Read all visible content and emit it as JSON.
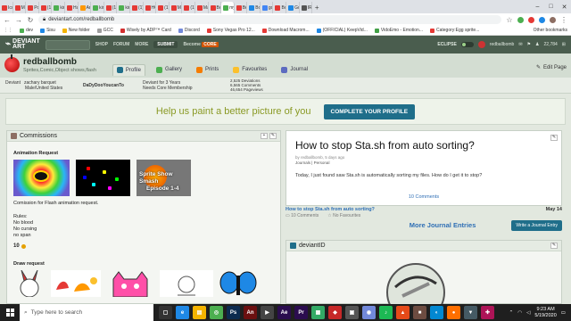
{
  "browser": {
    "tabs": [
      {
        "label": "Ico",
        "color": "#e53935"
      },
      {
        "label": "Ma",
        "color": "#e53935"
      },
      {
        "label": "Po",
        "color": "#e53935"
      },
      {
        "label": "(1)",
        "color": "#e53935"
      },
      {
        "label": "kin",
        "color": "#4caf50"
      },
      {
        "label": "Ha",
        "color": "#e53935"
      },
      {
        "label": "Ani",
        "color": "#ff9800"
      },
      {
        "label": "kin",
        "color": "#4caf50"
      },
      {
        "label": "(1)",
        "color": "#e53935"
      },
      {
        "label": "kin",
        "color": "#4caf50"
      },
      {
        "label": "(1)",
        "color": "#e53935"
      },
      {
        "label": "HC",
        "color": "#e53935"
      },
      {
        "label": "(1)",
        "color": "#e53935"
      },
      {
        "label": "Ma",
        "color": "#e53935"
      },
      {
        "label": "(1)",
        "color": "#e53935"
      },
      {
        "label": "Ma",
        "color": "#e53935"
      },
      {
        "label": "Bo",
        "color": "#e53935"
      },
      {
        "label": "my",
        "color": "#4caf50",
        "active": true
      },
      {
        "label": "Bo",
        "color": "#e53935"
      },
      {
        "label": "Bo",
        "color": "#1e88e5"
      },
      {
        "label": "goi",
        "color": "#4285f4"
      },
      {
        "label": "Bo",
        "color": "#e53935"
      },
      {
        "label": "Gu",
        "color": "#1e88e5"
      },
      {
        "label": "IR",
        "color": "#555"
      }
    ],
    "url": "deviantart.com/redballbomb",
    "bookmarks": [
      {
        "label": "dev",
        "color": "#4caf50"
      },
      {
        "label": "Sisu",
        "color": "#1e88e5"
      },
      {
        "label": "New folder",
        "color": "#f4b400"
      },
      {
        "label": "GCC",
        "color": "#9e9e9e"
      },
      {
        "label": "Wisely by ADP™ Card",
        "color": "#d32f2f"
      },
      {
        "label": "Discord",
        "color": "#7289da"
      },
      {
        "label": "Sony Vegas Pro 12...",
        "color": "#e53935"
      },
      {
        "label": "Download Macrom...",
        "color": "#e53935"
      },
      {
        "label": "(OFFICIAL) KeepVid...",
        "color": "#1e88e5"
      },
      {
        "label": "VidoEmo - Emotion...",
        "color": "#43a047"
      },
      {
        "label": "Category:Egg sprite...",
        "color": "#e53935"
      }
    ],
    "other_bookmarks": "Other bookmarks"
  },
  "da_header": {
    "logo_line1": "DEVIANT",
    "logo_line2": "ART",
    "nav": [
      "SHOP",
      "FORUM",
      "MORE"
    ],
    "submit": "SUBMIT",
    "core_prefix": "Become",
    "core_word": "CORE",
    "eclipse": "ECLIPSE",
    "username": "redballbomb",
    "points": "22,784"
  },
  "profile": {
    "name": "redballbomb",
    "tagline": "Sprites,Comic,Object shows,flash",
    "tabs": [
      {
        "label": "Profile",
        "color": "#1f6e8a",
        "active": true
      },
      {
        "label": "Gallery",
        "color": "#4caf50"
      },
      {
        "label": "Prints",
        "color": "#f57c00"
      },
      {
        "label": "Favourites",
        "color": "#fbc02d"
      },
      {
        "label": "Journal",
        "color": "#5c6bc0"
      }
    ],
    "edit": "Edit Page"
  },
  "stats": {
    "deviant_label": "Deviant",
    "real_name": "zachary barquet",
    "location": "Male/United States",
    "watch": "DaDyDooYoucanTo",
    "member_for": "Deviant for 3 Years",
    "core_status": "Needs Core Membership",
    "deviations": "2,525 Deviations",
    "comments": "6,565 Comments",
    "pageviews": "46,654 Pageviews"
  },
  "banner": {
    "text": "Help us paint a better picture of you",
    "button": "COMPLETE YOUR PROFILE"
  },
  "commissions": {
    "title": "Commissions",
    "section_title": "Animation Request",
    "thumb3_line1": "Sprite Show Smash",
    "thumb3_line2": "Episode 1-4",
    "description": "Comission for Flash animation request.",
    "rules_header": "Rules:",
    "rules": [
      "No  blood",
      "No cursing",
      "no span"
    ],
    "price": "10",
    "draw_title": "Draw request"
  },
  "journal": {
    "title": "How to stop Sta.sh from auto sorting?",
    "meta": "by redballbomb, 5 days ago",
    "meta2": "Journals | Personal",
    "body": "Today, I just found saw Sta.sh is automatically sorting my files. How do I get it to stop?",
    "comments_link": "10 Comments",
    "list_title": "How to stop Sta.sh from auto sorting?",
    "list_date": "May 14",
    "list_comments": "10 Comments",
    "list_favs": "No Favourites",
    "more": "More Journal Entries",
    "write": "Write a Journal Entry"
  },
  "deviantid": {
    "title": "deviantID"
  },
  "taskbar": {
    "search_placeholder": "Type here to search",
    "apps": [
      {
        "label": "▢",
        "color": "#333"
      },
      {
        "label": "e",
        "color": "#1e88e5"
      },
      {
        "label": "▤",
        "color": "#f4b400"
      },
      {
        "label": "◎",
        "color": "#4caf50"
      },
      {
        "label": "Ps",
        "color": "#0d2b4f"
      },
      {
        "label": "An",
        "color": "#6b1010"
      },
      {
        "label": "▶",
        "color": "#444"
      },
      {
        "label": "Ae",
        "color": "#2b0d4f"
      },
      {
        "label": "Pr",
        "color": "#2b0d4f"
      },
      {
        "label": "▦",
        "color": "#3a6"
      },
      {
        "label": "◆",
        "color": "#c62828"
      },
      {
        "label": "▣",
        "color": "#555"
      },
      {
        "label": "◉",
        "color": "#7289da"
      },
      {
        "label": "♪",
        "color": "#1db954"
      },
      {
        "label": "▲",
        "color": "#e64a19"
      },
      {
        "label": "■",
        "color": "#6d4c41"
      },
      {
        "label": "◐",
        "color": "#0288d1"
      },
      {
        "label": "●",
        "color": "#ff6f00"
      },
      {
        "label": "▼",
        "color": "#455a64"
      },
      {
        "label": "✚",
        "color": "#ad1457"
      }
    ],
    "time": "9:23 AM",
    "date": "5/19/2020"
  }
}
